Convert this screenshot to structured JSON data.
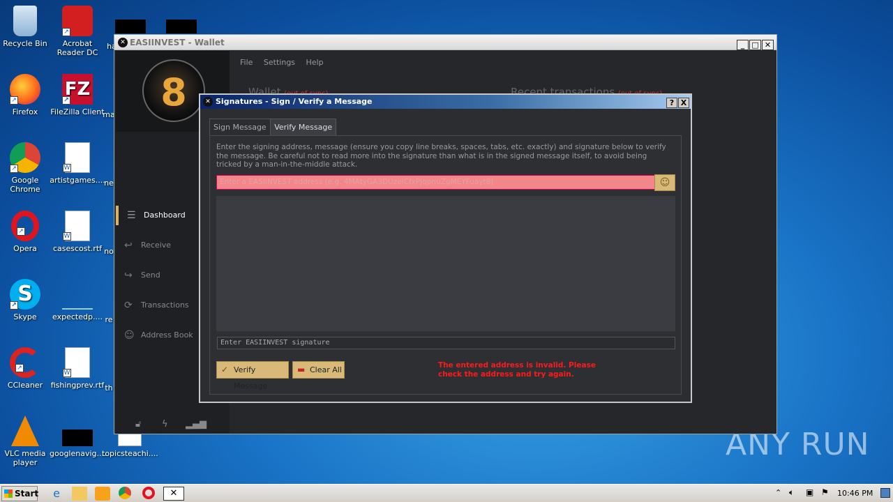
{
  "desktop": {
    "icons": [
      {
        "label": "Recycle Bin",
        "icon": "recycle-bin-icon"
      },
      {
        "label": "Acrobat Reader DC",
        "icon": "acrobat-icon"
      },
      {
        "label": "Firefox",
        "icon": "firefox-icon"
      },
      {
        "label": "FileZilla Client",
        "icon": "filezilla-icon"
      },
      {
        "label": "Google Chrome",
        "icon": "chrome-icon"
      },
      {
        "label": "artistgames....",
        "icon": "word-doc-icon"
      },
      {
        "label": "Opera",
        "icon": "opera-icon"
      },
      {
        "label": "casescost.rtf",
        "icon": "word-doc-icon"
      },
      {
        "label": "Skype",
        "icon": "skype-icon"
      },
      {
        "label": "expectedp....",
        "icon": "file-icon"
      },
      {
        "label": "CCleaner",
        "icon": "ccleaner-icon"
      },
      {
        "label": "fishingprev.rtf",
        "icon": "word-doc-icon"
      },
      {
        "label": "VLC media player",
        "icon": "vlc-icon"
      },
      {
        "label": "googlenavig....",
        "icon": "file-icon"
      },
      {
        "label": "topicsteachi....",
        "icon": "file-icon"
      }
    ],
    "partial_labels": [
      "ha",
      "ma",
      "ne",
      "no",
      "re",
      "th"
    ],
    "watermark": "ANY RUN"
  },
  "wallet": {
    "title": "EASIINVEST - Wallet",
    "menu": [
      "File",
      "Settings",
      "Help"
    ],
    "bg_left": {
      "title": "Wallet",
      "status": "(out of sync)"
    },
    "bg_right": {
      "title": "Recent transactions",
      "status": "(out of sync)"
    },
    "nav": [
      {
        "label": "Dashboard",
        "icon": "dashboard-icon",
        "active": true
      },
      {
        "label": "Receive",
        "icon": "receive-icon",
        "active": false
      },
      {
        "label": "Send",
        "icon": "send-icon",
        "active": false
      },
      {
        "label": "Transactions",
        "icon": "transactions-icon",
        "active": false
      },
      {
        "label": "Address Book",
        "icon": "address-book-icon",
        "active": false
      }
    ]
  },
  "dialog": {
    "title": "Signatures - Sign / Verify a Message",
    "help": "?",
    "close": "X",
    "tabs": [
      "Sign Message",
      "Verify Message"
    ],
    "description": "Enter the signing address, message (ensure you copy line breaks, spaces, tabs, etc. exactly) and signature below to verify the message. Be careful not to read more into the signature than what is in the signed message itself, to avoid being tricked by a man-in-the-middle attack.",
    "address_placeholder": "Enter a EASIINVEST address (e.g. 4MAtyGA3DUzeiCfxPjqpnuZgMEYFuayt8)",
    "signature_placeholder": "Enter EASIINVEST signature",
    "verify_label": "Verify Message",
    "clear_label": "Clear All",
    "error": "The entered address is invalid. Please check the address and try again."
  },
  "taskbar": {
    "start": "Start",
    "clock": "10:46 PM"
  }
}
